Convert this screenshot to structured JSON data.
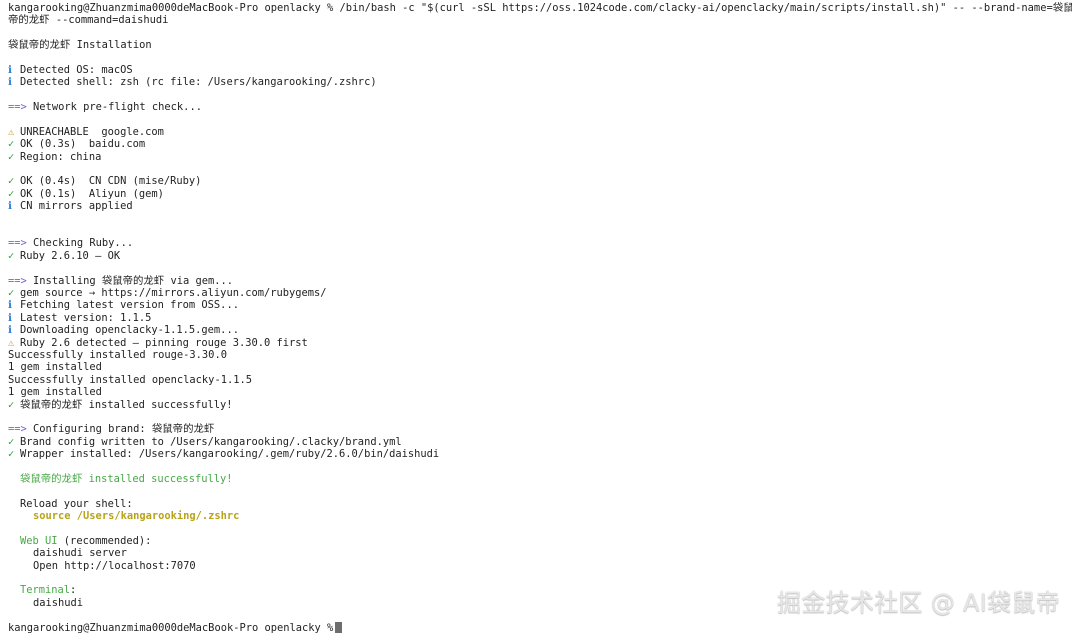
{
  "colors": {
    "background": "#ffffff",
    "text": "#1f1f1f",
    "info": "#2f7fd1",
    "ok": "#2ea043",
    "warning": "#c9a227",
    "arrow": "#6f63d8",
    "success_text": "#47a947",
    "path_text": "#b8a31a"
  },
  "terminal": {
    "prompt": "kangarooking@Zhuanzmima0000deMacBook-Pro openlacky %",
    "command": " /bin/bash -c \"$(curl -sSL https://oss.1024code.com/clacky-ai/openclacky/main/scripts/install.sh)\" -- --brand-name=袋鼠",
    "command_wrap": "帝的龙虾 --command=daishudi",
    "installation_title": "袋鼠帝的龙虾 Installation",
    "detected_os": "Detected OS: macOS",
    "detected_shell": "Detected shell: zsh (rc file: /Users/kangarooking/.zshrc)",
    "network_arrow": "==>",
    "network_check": "Network pre-flight check...",
    "unreachable_google": "UNREACHABLE  google.com",
    "ok_baidu": "OK (0.3s)  baidu.com",
    "region": "Region: china",
    "cn_cdn": "OK (0.4s)  CN CDN (mise/Ruby)",
    "aliyun": "OK (0.1s)  Aliyun (gem)",
    "mirrors": "CN mirrors applied",
    "ruby_arrow": "==>",
    "checking_ruby": "Checking Ruby...",
    "ruby_ok": "Ruby 2.6.10 — OK",
    "install_arrow": "==>",
    "installing": "Installing 袋鼠帝的龙虾 via gem...",
    "gem_source": "gem source → https://mirrors.aliyun.com/rubygems/",
    "fetching": "Fetching latest version from OSS...",
    "latest": "Latest version: 1.1.5",
    "downloading": "Downloading openclacky-1.1.5.gem...",
    "ruby_detected": "Ruby 2.6 detected — pinning rouge 3.30.0 first",
    "installed_rouge": "Successfully installed rouge-3.30.0",
    "one_gem_1": "1 gem installed",
    "installed_openclacky": "Successfully installed openclacky-1.1.5",
    "one_gem_2": "1 gem installed",
    "installed_success": "袋鼠帝的龙虾 installed successfully!",
    "configure_arrow": "==>",
    "configuring": "Configuring brand: 袋鼠帝的龙虾",
    "brand_config": "Brand config written to /Users/kangarooking/.clacky/brand.yml",
    "wrapper": "Wrapper installed: /Users/kangarooking/.gem/ruby/2.6.0/bin/daishudi",
    "final_success": "袋鼠帝的龙虾 installed successfully!",
    "reload_shell": "Reload your shell:",
    "source_cmd": "source /Users/kangarooking/.zshrc",
    "web_ui": "Web UI",
    "recommended": " (recommended):",
    "server_cmd": "daishudi server",
    "open_cmd": "Open http://localhost:7070",
    "terminal_label": "Terminal",
    "terminal_colon": ":",
    "terminal_cmd": "daishudi",
    "last_prompt": "kangarooking@Zhuanzmima0000deMacBook-Pro openlacky %"
  },
  "icons": {
    "info": "ℹ",
    "ok": "✓",
    "warning": "⚠"
  },
  "watermark": {
    "text": "掘金技术社区 @ AI袋鼠帝"
  }
}
